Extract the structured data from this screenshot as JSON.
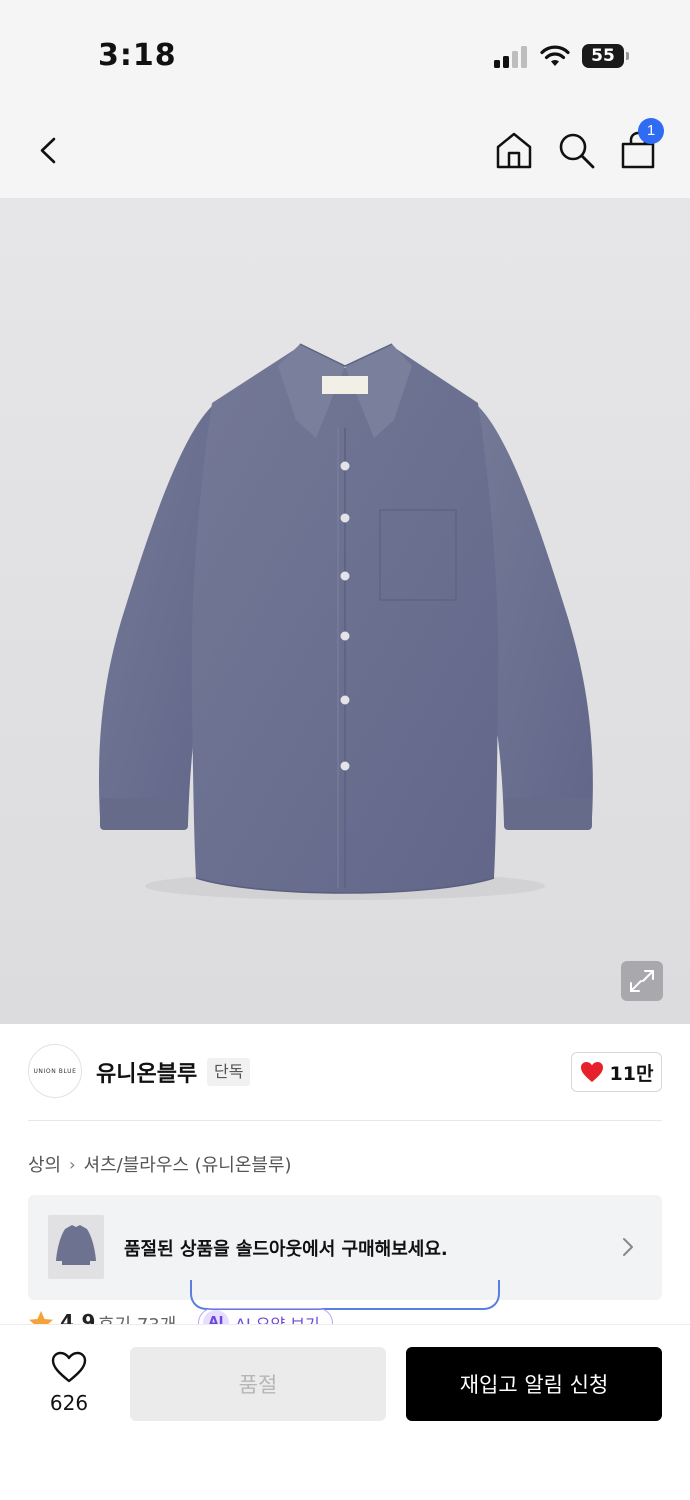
{
  "status_bar": {
    "time": "3:18",
    "battery_level": "55"
  },
  "nav": {
    "cart_count": "1"
  },
  "brand": {
    "logo_text": "UNION BLUE",
    "name": "유니온블루",
    "tag": "단독",
    "likes": "11만"
  },
  "breadcrumb": {
    "category": "상의",
    "subcategory": "셔츠/블라우스 (유니온블루)"
  },
  "soldout_banner": {
    "text": "품절된 상품을 솔드아웃에서 구매해보세요."
  },
  "rating": {
    "score": "4.9",
    "reviews": "후기 73개",
    "ai_badge": "AI",
    "ai_label": "AI 요약 보기"
  },
  "bottom_bar": {
    "wish_count": "626",
    "soldout_label": "품절",
    "restock_label": "재입고 알림 신청"
  },
  "colors": {
    "accent_blue": "#2f6bf3",
    "heart_red": "#e8202a",
    "shirt": "#6d7290",
    "ai_purple": "#6c4ad8"
  },
  "icons": [
    "back-icon",
    "home-icon",
    "search-icon",
    "cart-icon",
    "expand-icon",
    "heart-icon",
    "chevron-right-icon",
    "star-icon"
  ]
}
